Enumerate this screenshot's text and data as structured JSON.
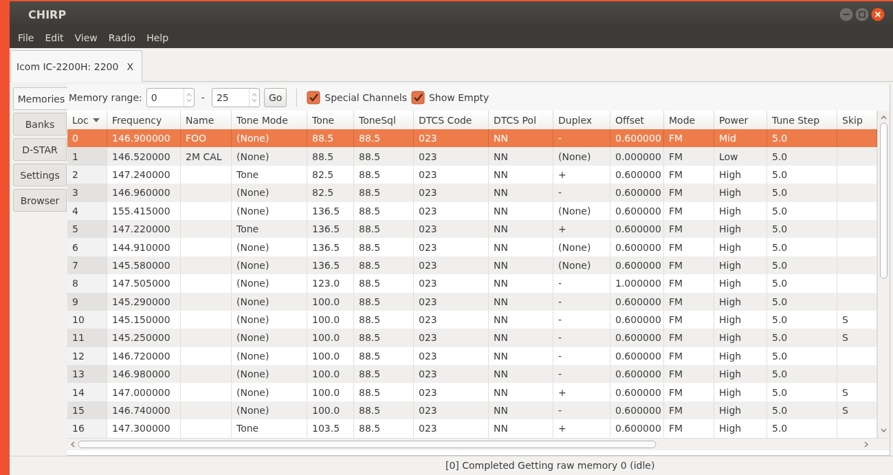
{
  "window": {
    "title": "CHIRP"
  },
  "menu": [
    "File",
    "Edit",
    "View",
    "Radio",
    "Help"
  ],
  "file_tabs": [
    {
      "label": "Icom IC-2200H: 2200",
      "close": "X",
      "selected": true
    }
  ],
  "side_tabs": [
    {
      "label": "Memories",
      "selected": true
    },
    {
      "label": "Banks",
      "selected": false
    },
    {
      "label": "D-STAR",
      "selected": false
    },
    {
      "label": "Settings",
      "selected": false
    },
    {
      "label": "Browser",
      "selected": false
    }
  ],
  "toolbar": {
    "range_label": "Memory range:",
    "range_start": "0",
    "separator": "-",
    "range_end": "25",
    "go": "Go",
    "special_channels": {
      "label": "Special Channels",
      "checked": true
    },
    "show_empty": {
      "label": "Show Empty",
      "checked": true
    }
  },
  "table": {
    "columns": [
      "Loc",
      "Frequency",
      "Name",
      "Tone Mode",
      "Tone",
      "ToneSql",
      "DTCS Code",
      "DTCS Pol",
      "Duplex",
      "Offset",
      "Mode",
      "Power",
      "Tune Step",
      "Skip"
    ],
    "rows": [
      {
        "cells": [
          "0",
          "146.900000",
          "FOO",
          "(None)",
          "88.5",
          "88.5",
          "023",
          "NN",
          "-",
          "0.600000",
          "FM",
          "Mid",
          "5.0",
          ""
        ],
        "selected": true
      },
      {
        "cells": [
          "1",
          "146.520000",
          "2M CAL",
          "(None)",
          "88.5",
          "88.5",
          "023",
          "NN",
          "(None)",
          "0.000000",
          "FM",
          "Low",
          "5.0",
          ""
        ],
        "selected": false
      },
      {
        "cells": [
          "2",
          "147.240000",
          "",
          "Tone",
          "82.5",
          "88.5",
          "023",
          "NN",
          "+",
          "0.600000",
          "FM",
          "High",
          "5.0",
          ""
        ],
        "selected": false
      },
      {
        "cells": [
          "3",
          "146.960000",
          "",
          "(None)",
          "82.5",
          "88.5",
          "023",
          "NN",
          "-",
          "0.600000",
          "FM",
          "High",
          "5.0",
          ""
        ],
        "selected": false
      },
      {
        "cells": [
          "4",
          "155.415000",
          "",
          "(None)",
          "136.5",
          "88.5",
          "023",
          "NN",
          "(None)",
          "0.600000",
          "FM",
          "High",
          "5.0",
          ""
        ],
        "selected": false
      },
      {
        "cells": [
          "5",
          "147.220000",
          "",
          "Tone",
          "136.5",
          "88.5",
          "023",
          "NN",
          "+",
          "0.600000",
          "FM",
          "High",
          "5.0",
          ""
        ],
        "selected": false
      },
      {
        "cells": [
          "6",
          "144.910000",
          "",
          "(None)",
          "136.5",
          "88.5",
          "023",
          "NN",
          "(None)",
          "0.600000",
          "FM",
          "High",
          "5.0",
          ""
        ],
        "selected": false
      },
      {
        "cells": [
          "7",
          "145.580000",
          "",
          "(None)",
          "136.5",
          "88.5",
          "023",
          "NN",
          "(None)",
          "0.600000",
          "FM",
          "High",
          "5.0",
          ""
        ],
        "selected": false
      },
      {
        "cells": [
          "8",
          "147.505000",
          "",
          "(None)",
          "123.0",
          "88.5",
          "023",
          "NN",
          "-",
          "1.000000",
          "FM",
          "High",
          "5.0",
          ""
        ],
        "selected": false
      },
      {
        "cells": [
          "9",
          "145.290000",
          "",
          "(None)",
          "100.0",
          "88.5",
          "023",
          "NN",
          "-",
          "0.600000",
          "FM",
          "High",
          "5.0",
          ""
        ],
        "selected": false
      },
      {
        "cells": [
          "10",
          "145.150000",
          "",
          "(None)",
          "100.0",
          "88.5",
          "023",
          "NN",
          "-",
          "0.600000",
          "FM",
          "High",
          "5.0",
          "S"
        ],
        "selected": false
      },
      {
        "cells": [
          "11",
          "145.250000",
          "",
          "(None)",
          "100.0",
          "88.5",
          "023",
          "NN",
          "-",
          "0.600000",
          "FM",
          "High",
          "5.0",
          "S"
        ],
        "selected": false
      },
      {
        "cells": [
          "12",
          "146.720000",
          "",
          "(None)",
          "100.0",
          "88.5",
          "023",
          "NN",
          "-",
          "0.600000",
          "FM",
          "High",
          "5.0",
          ""
        ],
        "selected": false
      },
      {
        "cells": [
          "13",
          "146.980000",
          "",
          "(None)",
          "100.0",
          "88.5",
          "023",
          "NN",
          "-",
          "0.600000",
          "FM",
          "High",
          "5.0",
          ""
        ],
        "selected": false
      },
      {
        "cells": [
          "14",
          "147.000000",
          "",
          "(None)",
          "100.0",
          "88.5",
          "023",
          "NN",
          "+",
          "0.600000",
          "FM",
          "High",
          "5.0",
          "S"
        ],
        "selected": false
      },
      {
        "cells": [
          "15",
          "146.740000",
          "",
          "(None)",
          "100.0",
          "88.5",
          "023",
          "NN",
          "-",
          "0.600000",
          "FM",
          "High",
          "5.0",
          "S"
        ],
        "selected": false
      },
      {
        "cells": [
          "16",
          "147.300000",
          "",
          "Tone",
          "103.5",
          "88.5",
          "023",
          "NN",
          "+",
          "0.600000",
          "FM",
          "High",
          "5.0",
          ""
        ],
        "selected": false
      }
    ]
  },
  "status_bar": "[0] Completed Getting raw memory 0 (idle)"
}
